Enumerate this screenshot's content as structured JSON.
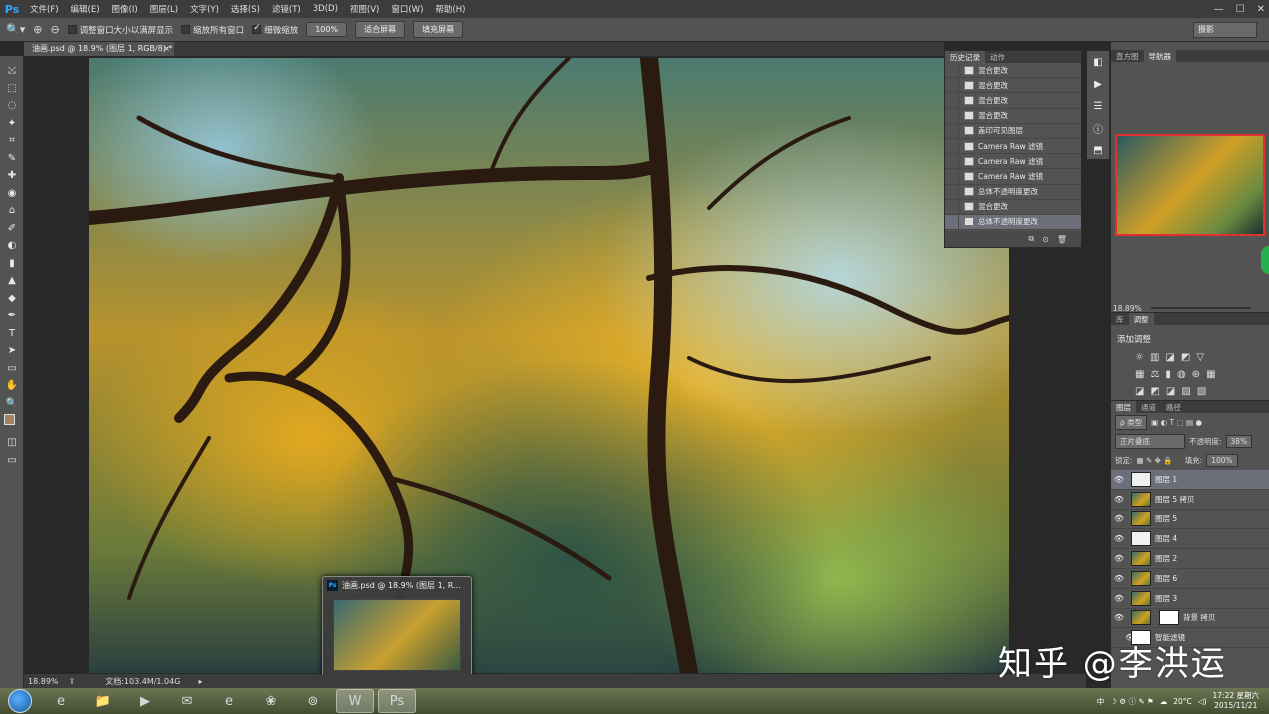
{
  "menubar": {
    "logo": "Ps",
    "items": [
      "文件(F)",
      "编辑(E)",
      "图像(I)",
      "图层(L)",
      "文字(Y)",
      "选择(S)",
      "滤镜(T)",
      "3D(D)",
      "视图(V)",
      "窗口(W)",
      "帮助(H)"
    ],
    "window_controls": [
      "—",
      "☐",
      "✕"
    ]
  },
  "options": {
    "opt1": "调整窗口大小以满屏显示",
    "opt2": "缩放所有窗口",
    "opt3": "细微缩放",
    "zoom_btn": "100%",
    "fit_btn": "适合屏幕",
    "fill_btn": "填充屏幕",
    "workspace": "摄影"
  },
  "doc": {
    "tab_title": "油画.psd @ 18.9% (图层 1, RGB/8) *",
    "tab_close": "×"
  },
  "tools": [
    "⤩",
    "⬚",
    "◌",
    "✦",
    "⌗",
    "✎",
    "✚",
    "◉",
    "⌂",
    "✐",
    "◐",
    "▮",
    "▲",
    "◆",
    "✒",
    "T",
    "➤",
    "▭",
    "✋",
    "🔍"
  ],
  "thumb_popup": {
    "title": "油画.psd @ 18.9% (图层 1, R..."
  },
  "status": {
    "zoom": "18.89%",
    "doc_info": "文档:103.4M/1.04G",
    "arrow": "▸"
  },
  "history": {
    "tabs": [
      "历史记录",
      "动作"
    ],
    "rows": [
      "混合更改",
      "混合更改",
      "混合更改",
      "混合更改",
      "盖印可见图层",
      "Camera Raw 滤镜",
      "Camera Raw 滤镜",
      "Camera Raw 滤镜",
      "总体不透明度更改",
      "混合更改",
      "总体不透明度更改"
    ],
    "footer_icons": [
      "⧉",
      "⊙",
      "🗑"
    ]
  },
  "dock": [
    "◧",
    "▶",
    "☰",
    "ⓘ",
    "⬒"
  ],
  "navigator": {
    "tabs": [
      "直方图",
      "导航器"
    ],
    "zoom": "18.89%"
  },
  "adjustments": {
    "tabs": [
      "库",
      "调整"
    ],
    "title": "添加调整",
    "row1": [
      "☼",
      "▥",
      "◪",
      "◩",
      "▽"
    ],
    "row2": [
      "▦",
      "⚖",
      "▮",
      "◍",
      "⊛",
      "▦"
    ],
    "row3": [
      "◪",
      "◩",
      "◪",
      "▨",
      "▧"
    ]
  },
  "layers": {
    "tabs": [
      "图层",
      "通道",
      "路径"
    ],
    "kind": "ρ 类型",
    "blend": "正片叠底",
    "opacity_label": "不透明度:",
    "opacity": "38%",
    "lock_label": "锁定:",
    "fill_label": "填充:",
    "fill": "100%",
    "items": [
      "图层 1",
      "图层 5 拷贝",
      "图层 5",
      "图层 4",
      "图层 2",
      "图层 6",
      "图层 3",
      "背景 拷贝",
      "智能滤镜"
    ]
  },
  "taskbar": {
    "apps": [
      "e",
      "📁",
      "▶",
      "✉",
      "e",
      "❀",
      "⊚",
      "W",
      "Ps"
    ],
    "tray_lang": "中",
    "weather": "20°C",
    "time": "17:22 星期六",
    "date": "2015/11/21"
  },
  "watermark": "知乎 @李洪运"
}
